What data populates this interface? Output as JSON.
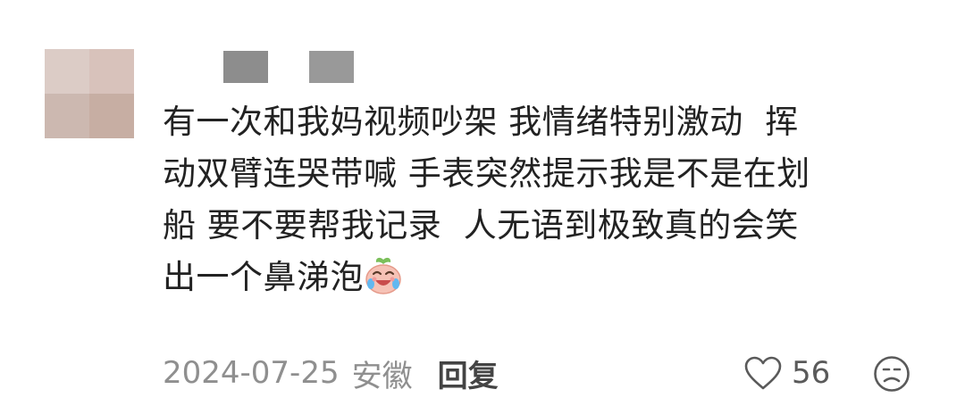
{
  "comment": {
    "lines": [
      "有一次和我妈视频吵架 我情绪特别激动  挥",
      "动双臂连哭带喊 手表突然提示我是不是在划",
      "船 要不要帮我记录  人无语到极致真的会笑",
      "出一个鼻涕泡"
    ],
    "emoji": "crying-laughing-sticker"
  },
  "meta": {
    "date": "2024-07-25",
    "location": "安徽",
    "reply_label": "回复"
  },
  "actions": {
    "like_count": "56",
    "like_icon": "heart-outline-icon",
    "dislike_icon": "sad-face-icon"
  },
  "colors": {
    "text": "#222222",
    "meta": "#8f8f8f",
    "icon": "#5a5a5a"
  }
}
